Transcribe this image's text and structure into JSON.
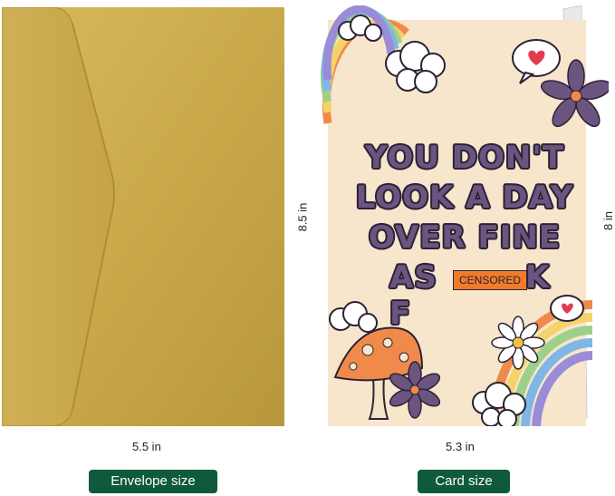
{
  "card": {
    "headline": [
      "YOU DON'T",
      "LOOK A DAY",
      "OVER FINE",
      "AS F"
    ],
    "censor_label": "CENSORED",
    "ending": "K"
  },
  "dimensions": {
    "envelope_height": "8.5 in",
    "envelope_width": "5.5 in",
    "card_height": "8 in",
    "card_width": "5.3 in"
  },
  "labels": {
    "envelope": "Envelope size",
    "card": "Card size"
  },
  "colors": {
    "envelope_gold": "#c9a94a",
    "card_background": "#f7e6cc",
    "label_green": "#0f5a3a",
    "headline_purple": "#6b5580"
  }
}
